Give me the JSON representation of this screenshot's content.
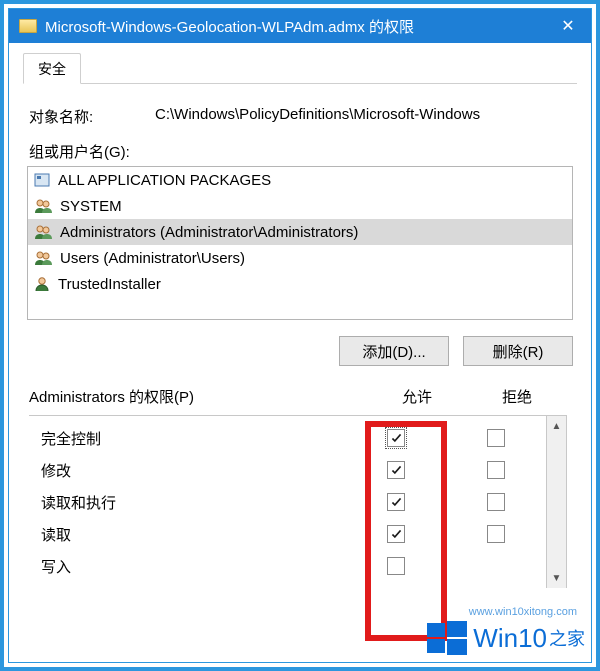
{
  "titlebar": {
    "title": "Microsoft-Windows-Geolocation-WLPAdm.admx 的权限"
  },
  "tab": {
    "security": "安全"
  },
  "object": {
    "label": "对象名称:",
    "value": "C:\\Windows\\PolicyDefinitions\\Microsoft-Windows"
  },
  "groups": {
    "label": "组或用户名(G):",
    "items": [
      {
        "name": "ALL APPLICATION PACKAGES",
        "icon": "packages"
      },
      {
        "name": "SYSTEM",
        "icon": "group"
      },
      {
        "name": "Administrators (Administrator\\Administrators)",
        "icon": "group",
        "selected": true
      },
      {
        "name": "Users (Administrator\\Users)",
        "icon": "group"
      },
      {
        "name": "TrustedInstaller",
        "icon": "user"
      }
    ]
  },
  "buttons": {
    "add": "添加(D)...",
    "remove": "删除(R)"
  },
  "permissions": {
    "header": "Administrators 的权限(P)",
    "allow": "允许",
    "deny": "拒绝",
    "rows": [
      {
        "name": "完全控制",
        "allow": true,
        "deny": false,
        "focus": true
      },
      {
        "name": "修改",
        "allow": true,
        "deny": false
      },
      {
        "name": "读取和执行",
        "allow": true,
        "deny": false
      },
      {
        "name": "读取",
        "allow": true,
        "deny": false
      },
      {
        "name": "写入",
        "allow": false,
        "deny": false,
        "hideDeny": true
      }
    ]
  },
  "watermark": {
    "brand": "Win10",
    "suffix": "之家",
    "url": "www.win10xitong.com"
  }
}
